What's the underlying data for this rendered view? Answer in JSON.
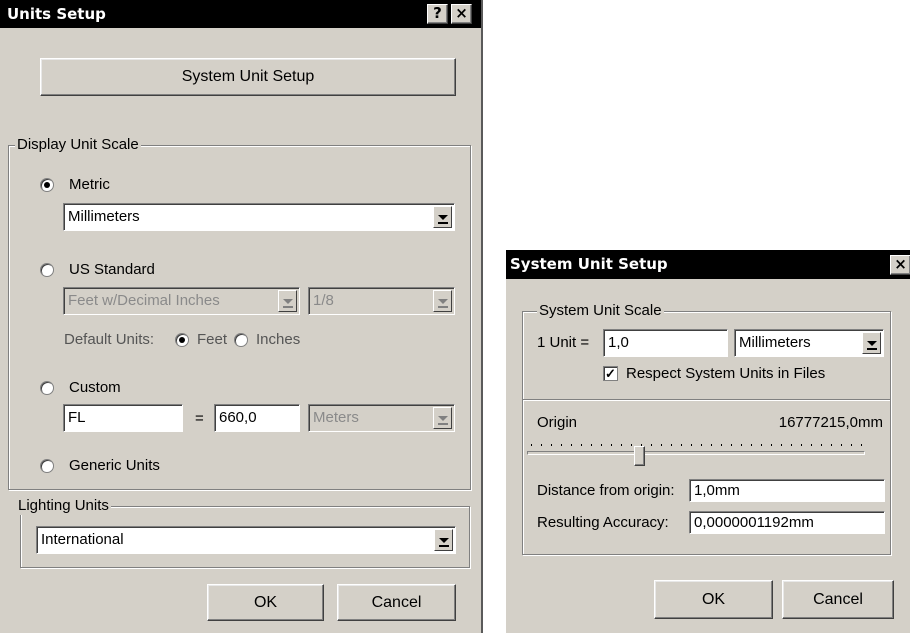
{
  "units_setup": {
    "title": "Units Setup",
    "help_glyph": "?",
    "close_glyph": "×",
    "system_unit_setup_button": "System Unit Setup",
    "display_unit_scale": {
      "legend": "Display Unit Scale",
      "selected": "Metric",
      "metric_label": "Metric",
      "metric_unit": "Millimeters",
      "us_standard_label": "US Standard",
      "us_unit": "Feet w/Decimal Inches",
      "us_fraction": "1/8",
      "default_units_label": "Default Units:",
      "default_units_options": [
        "Feet",
        "Inches"
      ],
      "default_units_selected": "Feet",
      "custom_label": "Custom",
      "custom_name": "FL",
      "custom_equals": "=",
      "custom_value": "660,0",
      "custom_unit": "Meters",
      "generic_label": "Generic Units"
    },
    "lighting_units": {
      "legend": "Lighting Units",
      "value": "International"
    },
    "ok_button": "OK",
    "cancel_button": "Cancel"
  },
  "system_unit_setup": {
    "title": "System Unit Setup",
    "close_glyph": "×",
    "system_unit_scale": {
      "legend": "System Unit Scale",
      "unit_label": "1 Unit =",
      "unit_value": "1,0",
      "unit_type": "Millimeters",
      "respect_label": "Respect System Units in Files",
      "respect_checked": true,
      "check_glyph": "✓"
    },
    "origin": {
      "label": "Origin",
      "value": "16777215,0mm",
      "slider_fraction": 0.33
    },
    "distance_label": "Distance from origin:",
    "distance_value": "1,0mm",
    "accuracy_label": "Resulting Accuracy:",
    "accuracy_value": "0,0000001192mm",
    "ok_button": "OK",
    "cancel_button": "Cancel"
  }
}
